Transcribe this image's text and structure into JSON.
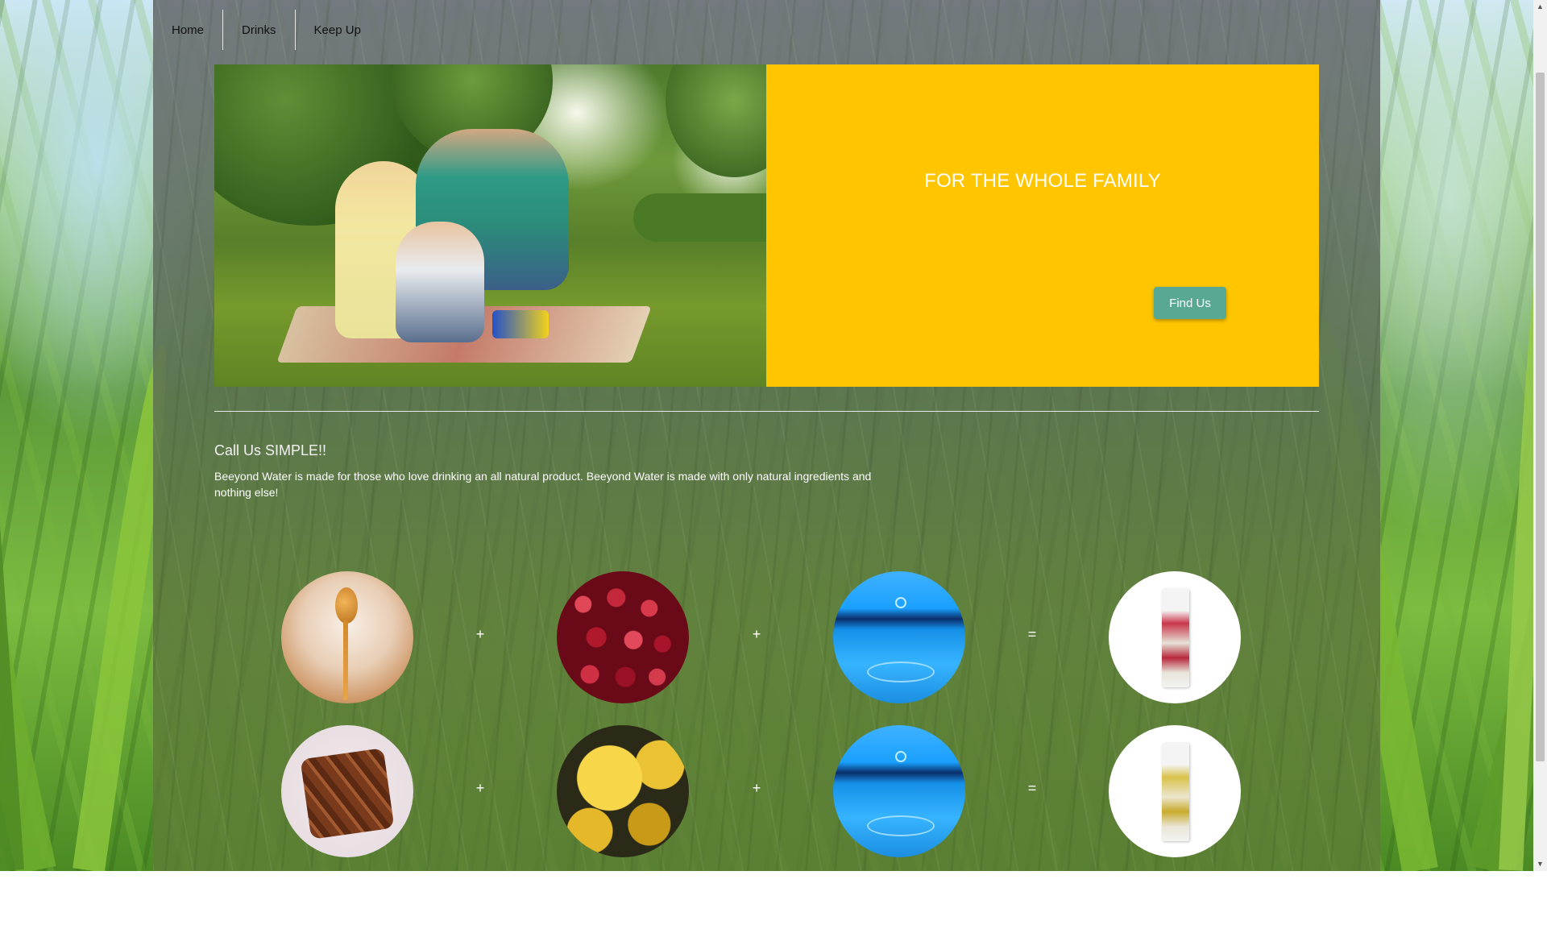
{
  "nav": {
    "items": [
      {
        "label": "Home"
      },
      {
        "label": "Drinks"
      },
      {
        "label": "Keep Up"
      }
    ]
  },
  "hero": {
    "title": "FOR THE WHOLE FAMILY",
    "button_label": "Find Us",
    "panel_color": "#ffc600",
    "button_color": "#59a894"
  },
  "about": {
    "title": "Call Us SIMPLE!!",
    "text": "Beeyond Water is made for those who love drinking an all natural product. Beeyond Water is made with only natural ingredients and nothing else!"
  },
  "recipes": [
    {
      "ingredients": [
        "honey",
        "cranberries",
        "water"
      ],
      "operators": [
        "+",
        "+",
        "="
      ],
      "result": "cranberry-drink-carton"
    },
    {
      "ingredients": [
        "cinnamon",
        "chrysanthemum",
        "water"
      ],
      "operators": [
        "+",
        "+",
        "="
      ],
      "result": "chrysanthemum-drink-carton"
    }
  ]
}
